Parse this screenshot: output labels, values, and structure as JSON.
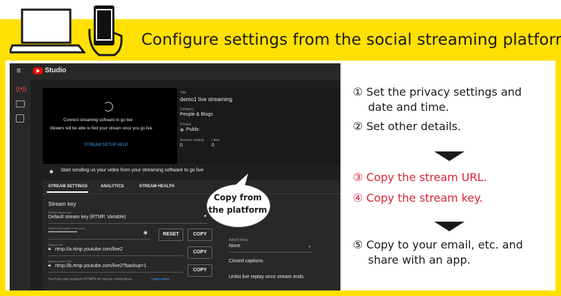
{
  "heading": "Configure settings from the social streaming platform",
  "bubble": {
    "line1": "Copy from",
    "line2": "the platform"
  },
  "steps": [
    {
      "num": "①",
      "line1": "Set the privacy settings and",
      "line2": "date and time."
    },
    {
      "num": "②",
      "line1": "Set other details."
    },
    {
      "num": "③",
      "line1": "Copy the stream URL."
    },
    {
      "num": "④",
      "line1": "Copy the stream key."
    },
    {
      "num": "⑤",
      "line1": "Copy to your email, etc. and",
      "line2": "share with an app."
    }
  ],
  "studio": {
    "brand": "Studio",
    "preview": {
      "line1": "Connect streaming software to go live",
      "line2": "Viewers will be able to find your stream once you go live",
      "link": "STREAM SETUP HELP"
    },
    "info": {
      "title_label": "Title",
      "title": "demo1 live streaming",
      "category_label": "Category",
      "category": "People & Blogs",
      "privacy_label": "Privacy",
      "privacy": "Public",
      "viewers_label": "Viewers waiting",
      "viewers": "0",
      "likes_label": "Likes",
      "likes": "0"
    },
    "status": "Start sending us your video from your streaming software to go live",
    "tabs": [
      "STREAM SETTINGS",
      "ANALYTICS",
      "STREAM HEALTH"
    ],
    "stream_key_title": "Stream key",
    "select_label": "Default stream key",
    "select_value": "Default stream key (RTMP, Variable)",
    "key_label": "Stream key (paste in encoder)",
    "key_value": "••••••••••••••••••••",
    "reset": "RESET",
    "copy": "COPY",
    "url_label": "Stream URL",
    "url_value": "rtmp://a.rtmp.youtube.com/live2",
    "backup_label": "Backup server URL",
    "backup_value": "rtmp://b.rtmp.youtube.com/live2?backup=1",
    "footer": "YouTube also supports RTMPS for secure connections.",
    "learn_more": "Learn more",
    "delay_label": "Added delay",
    "delay_value": "None",
    "captions": "Closed captions",
    "unlist": "Unlist live replay once stream ends"
  },
  "colors": {
    "yellow": "#ffe000",
    "red": "#d6243a",
    "brand": "#ff0000"
  }
}
